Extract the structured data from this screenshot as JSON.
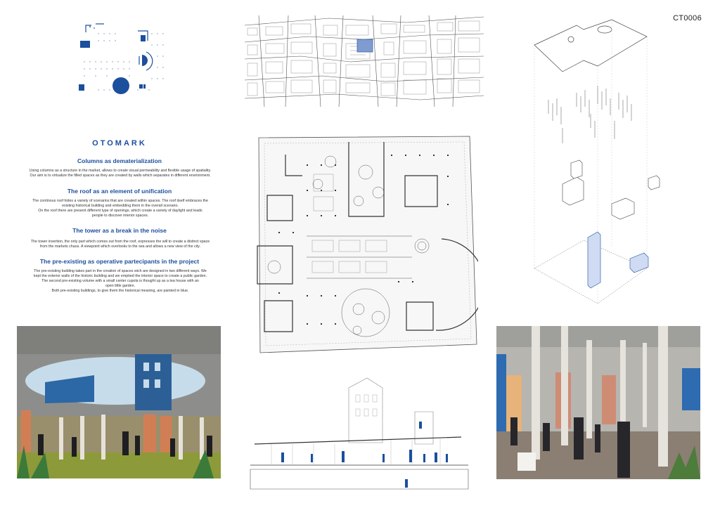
{
  "code": "CT0006",
  "title": "OTOMARK",
  "sections": [
    {
      "heading": "Columns as dematerialization",
      "lines": [
        "Using columns as a structure in the market, allows to create visual permeability and flexible usage of spatiality.",
        "Our aim is to virtualize the filled spaces as they are created by walls which separates in different environment."
      ]
    },
    {
      "heading": "The roof as an element of unification",
      "lines": [
        "The continous roof hides a variety of scenarios that are created within spaces. The roof itself embraces the",
        "existing historical building and embedding them in the overall scenario.",
        "On the roof there are present different type of openings, which create a variety of daylight and leads",
        "people to discover interior spaces."
      ]
    },
    {
      "heading": "The tower as a break in the noise",
      "lines": [
        "The tower insertion, the only part which comes out from the roof, expresses the will to create a distinct space",
        "from the markets chaos. A viewpoint which overlooks to the sea and allows a new view of the city."
      ]
    },
    {
      "heading": "The pre-existing as operative partecipants in the project",
      "lines": [
        "The pre-existing building takes part in the creation of spaces wich are designed in two different ways. We",
        "kept the exterior walls of the historic building and we emptied the interior space to create a public garden.",
        "The second pre-existing volume with a small center cupola is thought up as a tea house with an",
        "open little garden.",
        "Both pre-existing buildings, to give them the historical meaning, are painted in blue."
      ]
    }
  ],
  "colors": {
    "accent": "#1c4f9c",
    "line": "#555555",
    "concrete": "#8c8d8a"
  },
  "drawings": [
    "concept-diagram",
    "site-plan",
    "floor-plan",
    "exploded-axonometry",
    "section",
    "render-courtyard",
    "render-interior"
  ]
}
